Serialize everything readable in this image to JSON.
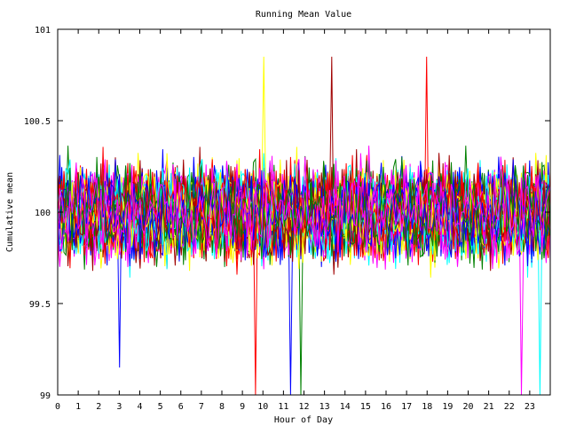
{
  "chart_data": {
    "type": "line",
    "title": "Running Mean Value",
    "xlabel": "Hour of Day",
    "ylabel": "Cumulative mean",
    "xlim": [
      0,
      24
    ],
    "ylim": [
      99,
      101
    ],
    "xticks": [
      0,
      1,
      2,
      3,
      4,
      5,
      6,
      7,
      8,
      9,
      10,
      11,
      12,
      13,
      14,
      15,
      16,
      17,
      18,
      19,
      20,
      21,
      22,
      23
    ],
    "xtick_labels": [
      "0",
      "1",
      "2",
      "3",
      "4",
      "5",
      "6",
      "7",
      "8",
      "9",
      "10",
      "11",
      "12",
      "13",
      "14",
      "15",
      "16",
      "17",
      "18",
      "19",
      "20",
      "21",
      "22",
      "23"
    ],
    "yticks": [
      99,
      99.5,
      100,
      100.5,
      101
    ],
    "ytick_labels": [
      "99",
      "99.5",
      "100",
      "100.5",
      "101"
    ],
    "grid": false,
    "legend": "none",
    "series_colors": [
      "#ff0000",
      "#0000ff",
      "#008000",
      "#ff00ff",
      "#00ffff",
      "#ffff00",
      "#a00000"
    ],
    "series_count": 60,
    "points_per_series": 240,
    "center_value": 100,
    "typical_range": [
      99.5,
      100.6
    ],
    "extremes": [
      {
        "x": 9.6,
        "y": 99
      },
      {
        "x": 11.3,
        "y": 99
      },
      {
        "x": 11.8,
        "y": 99
      },
      {
        "x": 22.6,
        "y": 99
      },
      {
        "x": 23.5,
        "y": 99
      },
      {
        "x": 10.0,
        "y": 100.85
      },
      {
        "x": 13.4,
        "y": 100.85
      },
      {
        "x": 18.0,
        "y": 100.85
      },
      {
        "x": 3.0,
        "y": 99.15
      }
    ]
  }
}
